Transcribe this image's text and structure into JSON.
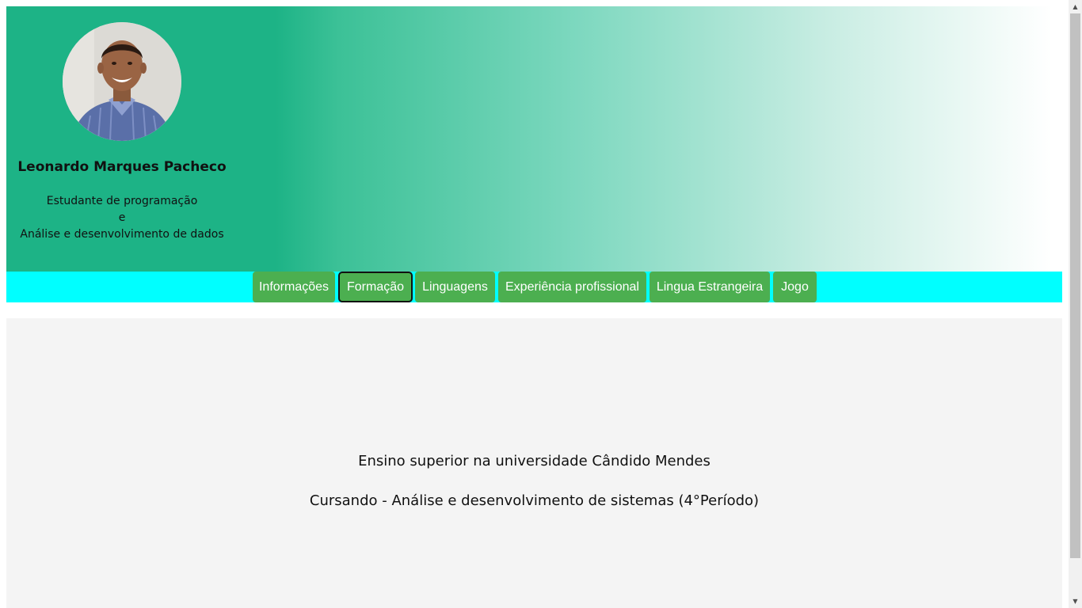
{
  "profile": {
    "avatar_icon": "profile-photo",
    "name": "Leonardo Marques Pacheco",
    "bio_lines": [
      "Estudante de programação",
      "e",
      "Análise e desenvolvimento de dados"
    ]
  },
  "nav": {
    "items": [
      {
        "label": "Informações"
      },
      {
        "label": "Formação",
        "active": true
      },
      {
        "label": "Linguagens"
      },
      {
        "label": "Experiência profissional"
      },
      {
        "label": "Lingua Estrangeira"
      },
      {
        "label": "Jogo"
      }
    ]
  },
  "content": {
    "lines": [
      "Ensino superior na universidade Cândido Mendes",
      "Cursando - Análise e desenvolvimento de sistemas (4°Período)"
    ]
  },
  "colors": {
    "header_start": "#1db386",
    "header_end": "#ffffff",
    "nav_bar": "#00ffff",
    "button": "#4caf50",
    "content_bg": "#f4f4f4"
  }
}
